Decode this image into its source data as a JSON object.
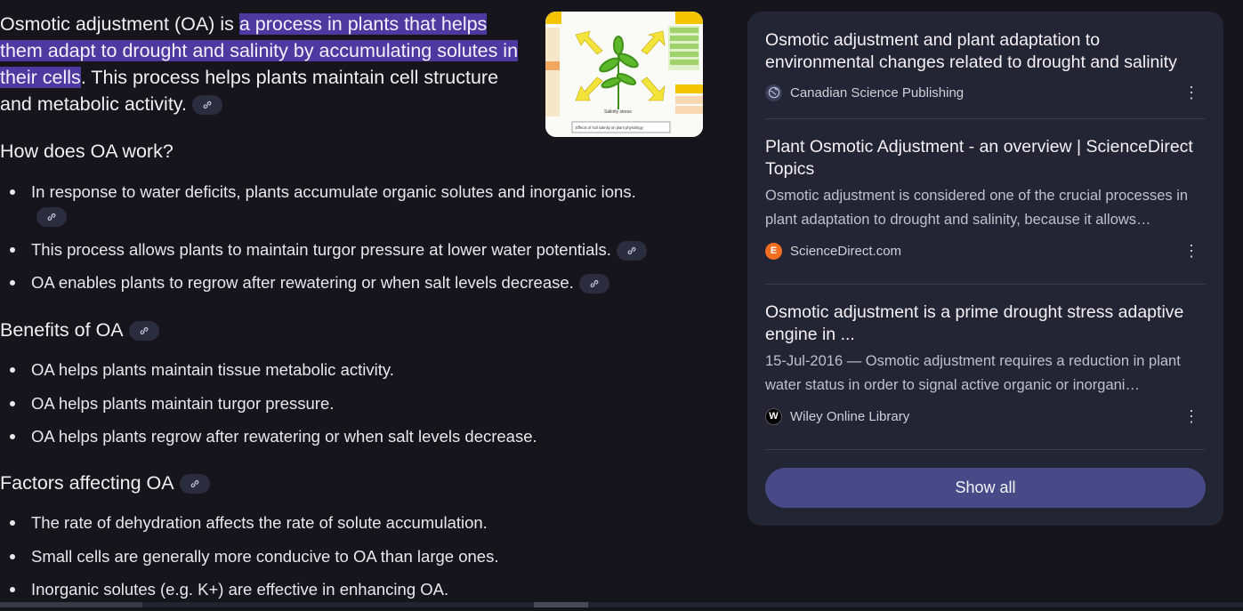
{
  "overview": {
    "intro_before": "Osmotic adjustment (OA) is ",
    "intro_highlight": "a process in plants that helps them adapt to drought and salinity by accumulating solutes in their cells",
    "intro_after": ". This process helps plants maintain cell structure and metabolic activity.",
    "sections": [
      {
        "heading": "How does OA work?",
        "items": [
          "In response to water deficits, plants accumulate organic solutes and inorganic ions.",
          "This process allows plants to maintain turgor pressure at lower water potentials.",
          "OA enables plants to regrow after rewatering or when salt levels decrease."
        ]
      },
      {
        "heading": "Benefits of OA",
        "items": [
          "OA helps plants maintain tissue metabolic activity.",
          "OA helps plants maintain turgor pressure.",
          "OA helps plants regrow after rewatering or when salt levels decrease."
        ]
      },
      {
        "heading": "Factors affecting OA",
        "items": [
          "The rate of dehydration affects the rate of solute accumulation.",
          "Small cells are generally more conducive to OA than large ones.",
          "Inorganic solutes (e.g. K+) are effective in enhancing OA."
        ]
      }
    ],
    "thumbnail": {
      "labels": [
        "Salinity stress",
        "Effects of soil salinity on plant physiology",
        "Tissue level",
        "Plant level"
      ]
    }
  },
  "sources": [
    {
      "title": "Osmotic adjustment and plant adaptation to environmental changes related to drought and salinity",
      "snippet": "",
      "site": "Canadian Science Publishing",
      "icon": "globe-icon"
    },
    {
      "title": "Plant Osmotic Adjustment - an overview | ScienceDirect Topics",
      "snippet": "Osmotic adjustment is considered one of the crucial processes in plant adaptation to drought and salinity, because it allows…",
      "site": "ScienceDirect.com",
      "icon": "sciencedirect-icon"
    },
    {
      "title": "Osmotic adjustment is a prime drought stress adaptive engine in ...",
      "snippet": "15-Jul-2016 — Osmotic adjustment requires a reduction in plant water status in order to signal active organic or inorgani…",
      "site": "Wiley Online Library",
      "icon": "wiley-icon"
    }
  ],
  "show_all_label": "Show all",
  "colors": {
    "background": "#16151c",
    "highlight": "#4c3aa0",
    "panel": "#232434",
    "button": "#474a86"
  }
}
